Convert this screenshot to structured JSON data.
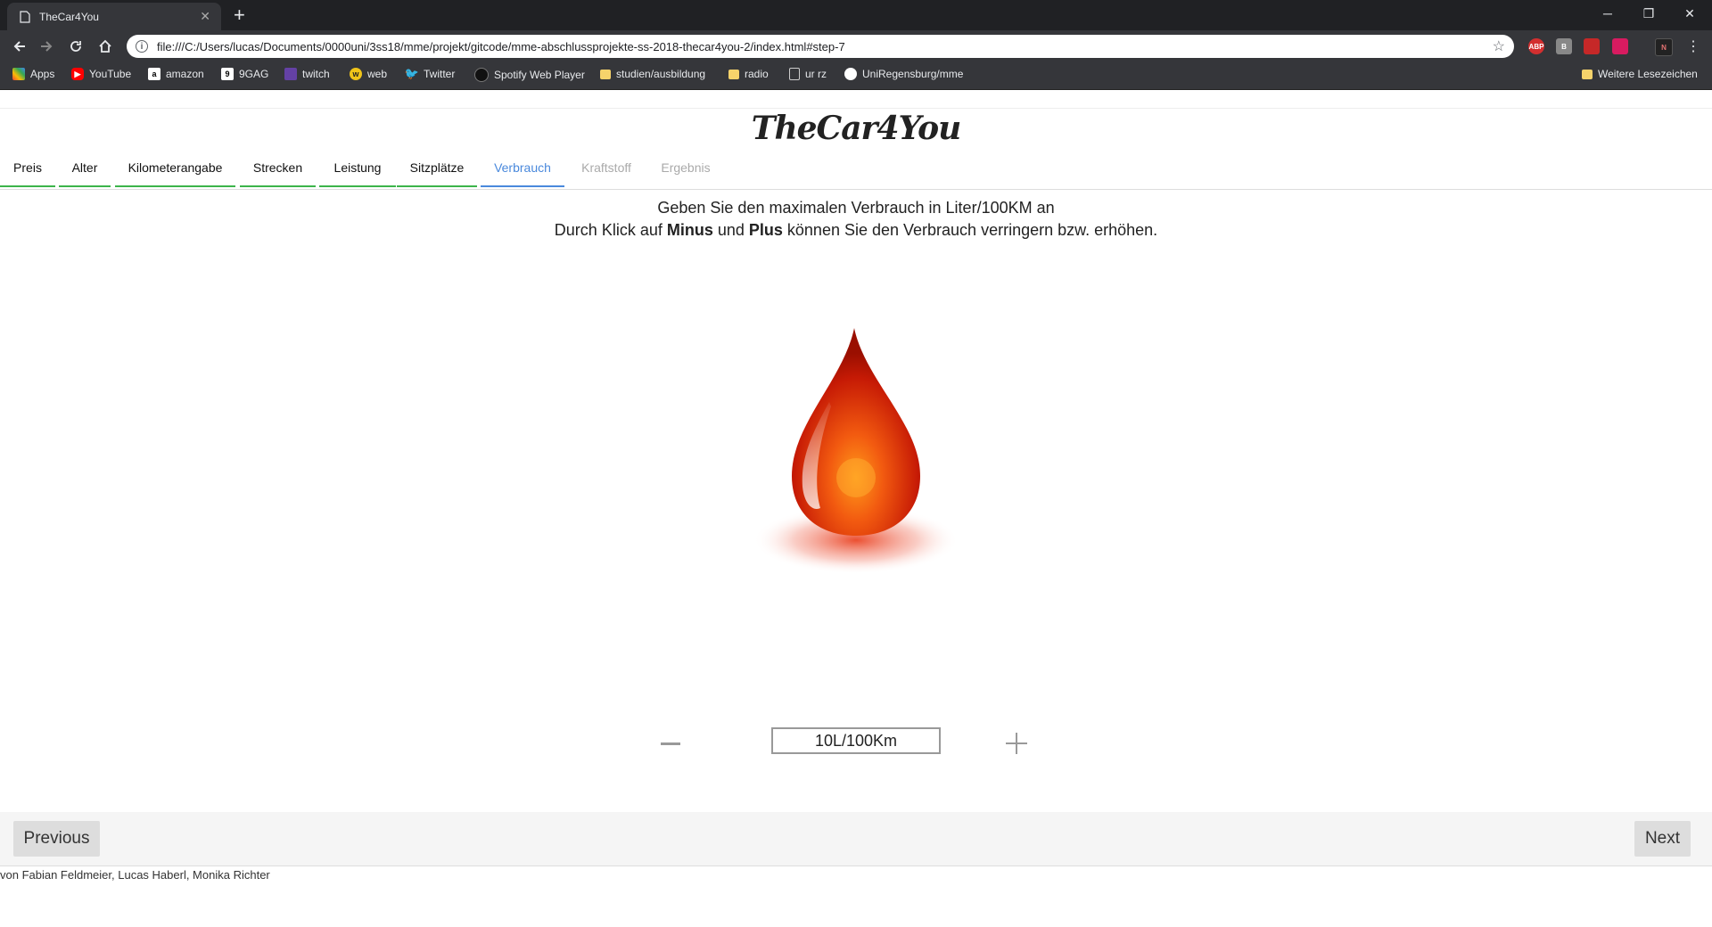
{
  "browser": {
    "tab_title": "TheCar4You",
    "url": "file:///C:/Users/lucas/Documents/0000uni/3ss18/mme/projekt/gitcode/mme-abschlussprojekte-ss-2018-thecar4you-2/index.html#step-7",
    "bookmarks": [
      "Apps",
      "YouTube",
      "amazon",
      "9GAG",
      "twitch",
      "web",
      "Twitter",
      "Spotify Web Player",
      "studien/ausbildung",
      "radio",
      "ur rz",
      "UniRegensburg/mme"
    ],
    "other_bookmarks": "Weitere Lesezeichen",
    "extensions": [
      "ABP",
      "B",
      "",
      "",
      "N"
    ]
  },
  "app": {
    "brand": "TheCar4You",
    "steps": [
      "Preis",
      "Alter",
      "Kilometerangabe",
      "Strecken",
      "Leistung",
      "Sitzplätze",
      "Verbrauch",
      "Kraftstoff",
      "Ergebnis"
    ],
    "active_step": "Verbrauch",
    "instruction_line1": "Geben Sie den maximalen Verbrauch in Liter/100KM an",
    "instruction_line2_pre": "Durch Klick auf ",
    "instruction_minus": "Minus",
    "instruction_mid": " und ",
    "instruction_plus": "Plus",
    "instruction_line2_post": " können Sie den Verbrauch verringern bzw. erhöhen.",
    "value": "10L/100Km",
    "previous_label": "Previous",
    "next_label": "Next",
    "footer": "von Fabian Feldmeier, Lucas Haberl, Monika Richter"
  },
  "colors": {
    "active_tab": "#4a89dc",
    "completed_underline": "#3cb44b",
    "drop": "#e8400c"
  }
}
